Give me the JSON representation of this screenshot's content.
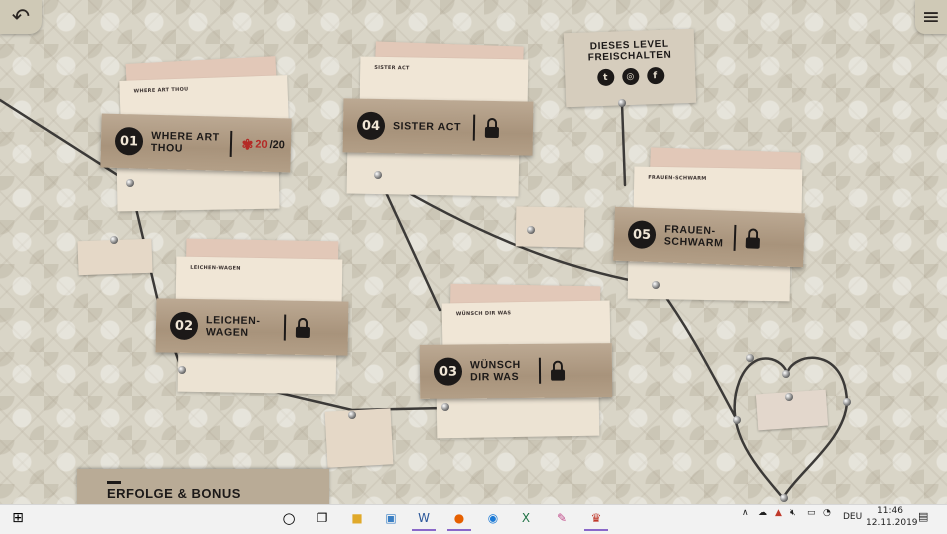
{
  "levels": [
    {
      "number": "01",
      "title_line1": "WHERE ART",
      "title_line2": "THOU",
      "score": "20",
      "max": "/20",
      "locked": false,
      "ticket_label": "WHERE ART THOU"
    },
    {
      "number": "02",
      "title_line1": "LEICHEN-",
      "title_line2": "WAGEN",
      "locked": true,
      "ticket_label": "LEICHEN-WAGEN"
    },
    {
      "number": "03",
      "title_line1": "WÜNSCH",
      "title_line2": "DIR WAS",
      "locked": true,
      "ticket_label": "WÜNSCH DIR WAS"
    },
    {
      "number": "04",
      "title_line1": "SISTER ACT",
      "title_line2": "",
      "locked": true,
      "ticket_label": "SISTER ACT"
    },
    {
      "number": "05",
      "title_line1": "FRAUEN-",
      "title_line2": "SCHWARM",
      "locked": true,
      "ticket_label": "FRAUEN-SCHWARM"
    }
  ],
  "unlock": {
    "line1": "DIESES LEVEL",
    "line2": "FREISCHALTEN",
    "socials": [
      "twitter-icon",
      "instagram-icon",
      "facebook-icon"
    ]
  },
  "bonus": {
    "title": "ERFOLGE & BONUS"
  },
  "icons": {
    "back": "back-arrow-icon",
    "menu": "hamburger-menu-icon"
  },
  "colors": {
    "ink": "#1c1918",
    "tape": "#a8937b",
    "score_red": "#b42a26",
    "thread": "#3c3a38"
  },
  "taskbar": {
    "language": "DEU",
    "time": "11:46",
    "date": "12.11.2019"
  }
}
